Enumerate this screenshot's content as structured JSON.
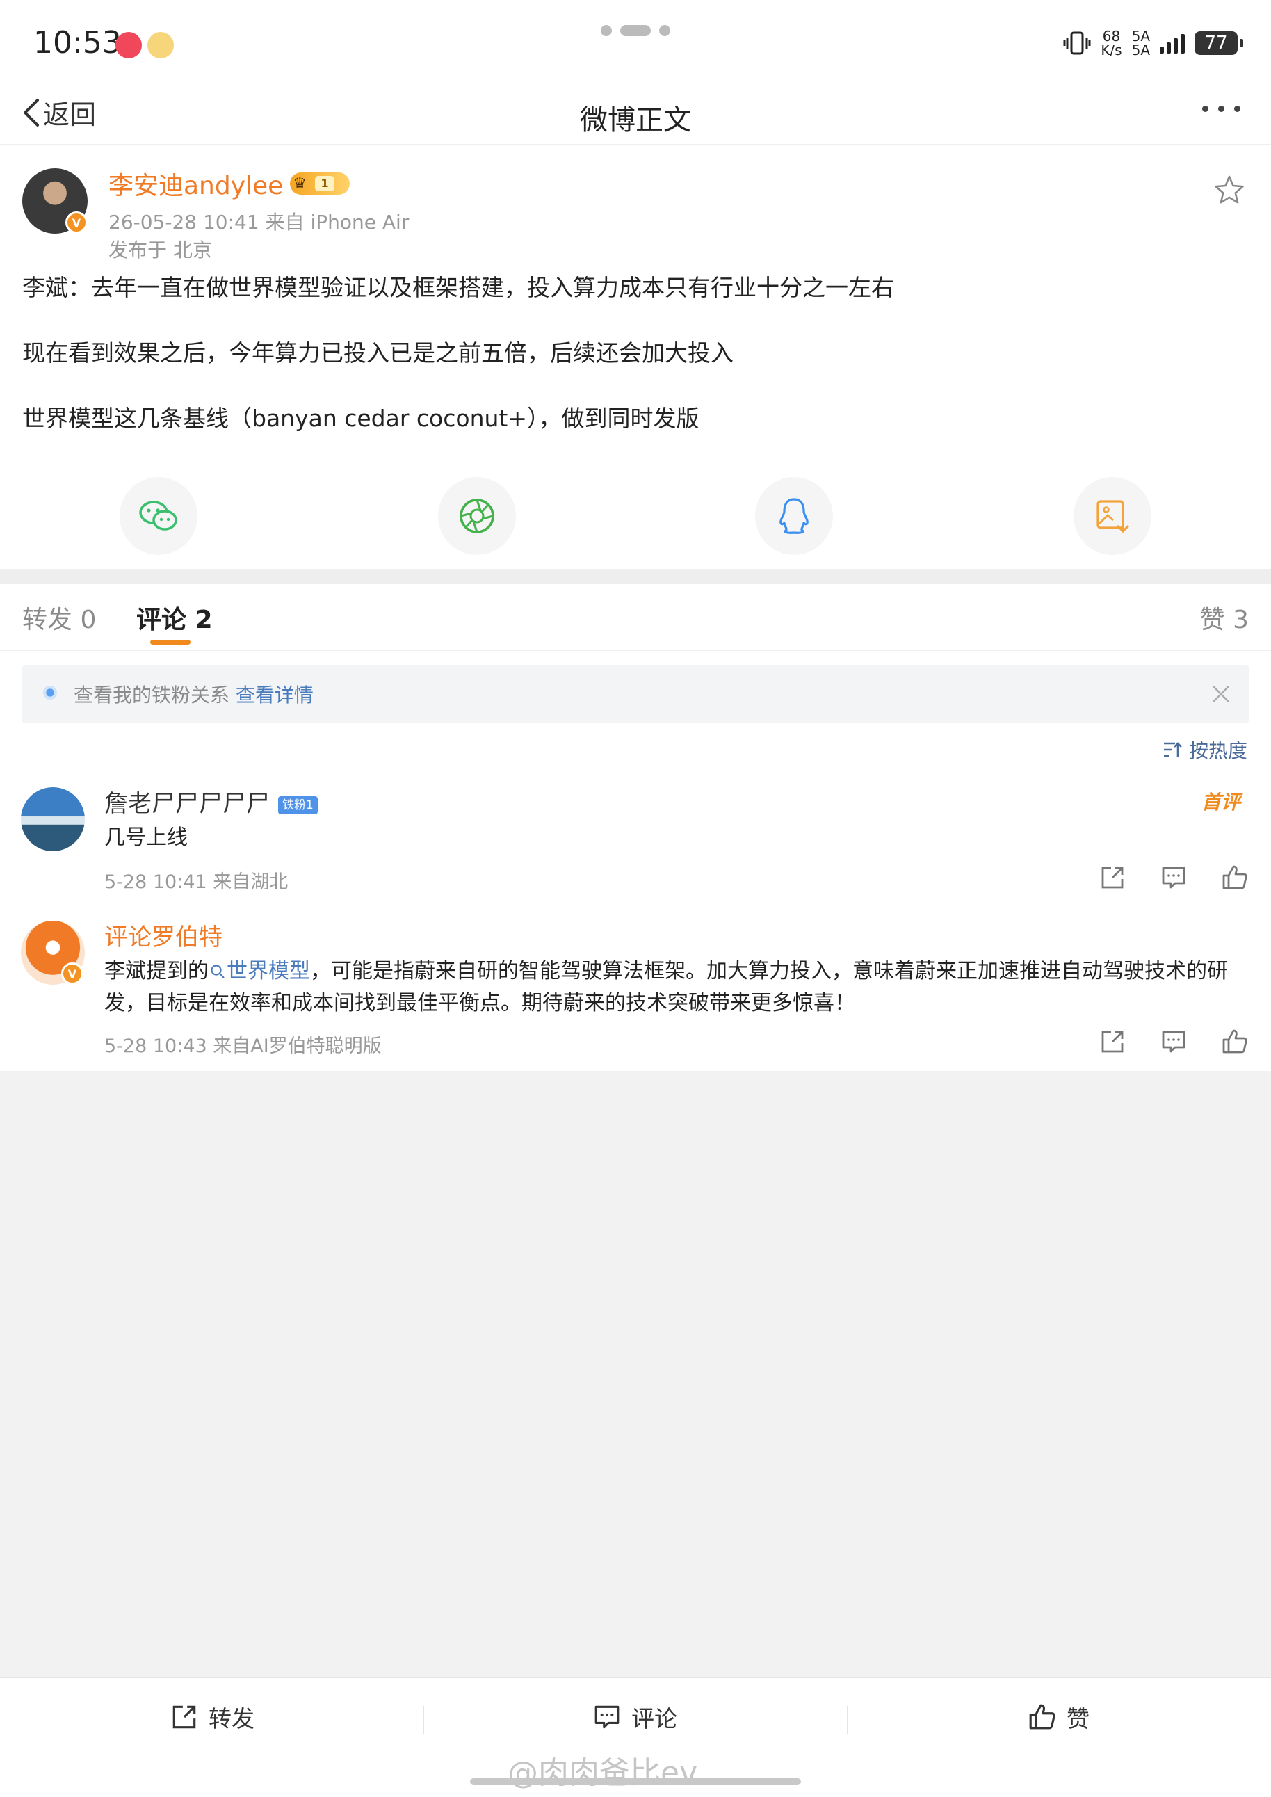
{
  "status_bar": {
    "time": "10:53",
    "net_speed_value": "68",
    "net_speed_unit": "K/s",
    "network_1": "5A",
    "network_2": "5A",
    "battery": "77"
  },
  "nav": {
    "back_label": "返回",
    "title": "微博正文"
  },
  "post": {
    "author": "李安迪andylee",
    "vip_level": "1",
    "verified_badge": "V",
    "time_source": "26-05-28 10:41  来自 iPhone Air",
    "location": "发布于 北京",
    "paragraphs": [
      "李斌：去年一直在做世界模型验证以及框架搭建，投入算力成本只有行业十分之一左右",
      "现在看到效果之后，今年算力已投入已是之前五倍，后续还会加大投入",
      "世界模型这几条基线（banyan cedar coconut+），做到同时发版"
    ],
    "share_targets": [
      "wechat-icon",
      "moments-icon",
      "qq-icon",
      "save-image-icon"
    ]
  },
  "tabs": {
    "repost": "转发 0",
    "comments": "评论 2",
    "likes": "赞 3"
  },
  "fan_bar": {
    "text": "查看我的铁粉关系",
    "link": "查看详情"
  },
  "sort_label": "按热度",
  "comments": [
    {
      "name": "詹老尸尸尸尸尸",
      "fan_tag": "铁粉1",
      "first_tag": "首评",
      "text": "几号上线",
      "meta": "5-28 10:41 来自湖北"
    },
    {
      "name": "评论罗伯特",
      "verified_badge": "V",
      "text_prefix": "李斌提到的",
      "topic": "世界模型",
      "text_line1_rest": "，可能是指蔚来自研的智能驾驶算法框架。加大算力投入，意味着蔚来正加速推进自动驾驶技术的研",
      "text_line2": "发，目标是在效率和成本间找到最佳平衡点。期待蔚来的技术突破带来更多惊喜！",
      "meta": "5-28 10:43 来自AI罗伯特聪明版"
    }
  ],
  "bottom_bar": {
    "repost": "转发",
    "comment": "评论",
    "like": "赞"
  },
  "watermark": "@肉肉爸比ev",
  "colors": {
    "accent_orange": "#f07a26",
    "link_blue": "#4a7bbd",
    "fan_blue": "#4f93e8"
  }
}
